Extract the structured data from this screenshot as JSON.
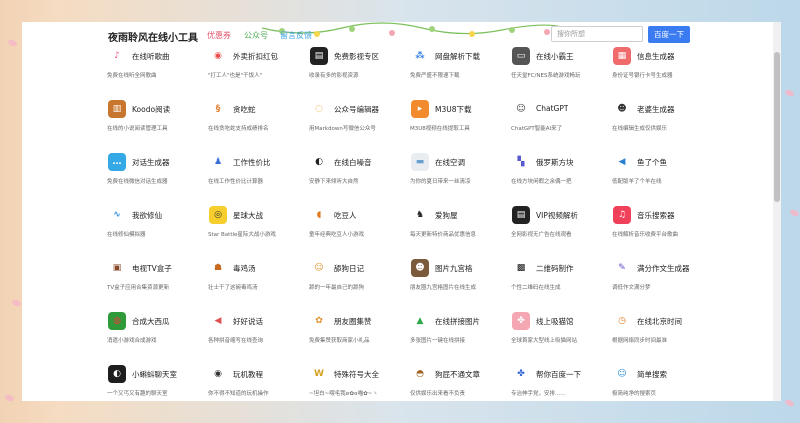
{
  "header": {
    "site_title": "夜雨聆风在线小工具",
    "nav": [
      {
        "label": "优惠券",
        "color": "#e2556c"
      },
      {
        "label": "公众号",
        "color": "#4caf50"
      },
      {
        "label": "留言反馈",
        "color": "#3aa0e0"
      }
    ],
    "search_placeholder": "搜你所想",
    "search_button": "百度一下"
  },
  "tools": [
    {
      "name": "在线听歌曲",
      "desc": "免费在线听全网歌曲",
      "icon": "music-note-icon",
      "glyph": "♪",
      "color": "#ffffff",
      "fg": "#e94c89"
    },
    {
      "name": "外卖折扣红包",
      "desc": "\"打工人\"也是\"干饭人\"",
      "icon": "food-bowl-icon",
      "glyph": "◉",
      "color": "#ffffff",
      "fg": "#e94c4c"
    },
    {
      "name": "免费影视专区",
      "desc": "收录有多的影视资源",
      "icon": "clapper-icon",
      "glyph": "▤",
      "color": "#222222",
      "fg": "#ffffff"
    },
    {
      "name": "网盘解析下载",
      "desc": "免费严盛不限速下载",
      "icon": "cloud-share-icon",
      "glyph": "⁂",
      "color": "#ffffff",
      "fg": "#2b7be5"
    },
    {
      "name": "在线小霸王",
      "desc": "任天堂FC/NES系统游戏畅玩",
      "icon": "game-console-icon",
      "glyph": "▭",
      "color": "#555555",
      "fg": "#ffffff"
    },
    {
      "name": "信息生成器",
      "desc": "身份证号银行卡号生成器",
      "icon": "id-card-icon",
      "glyph": "▦",
      "color": "#f06b6b",
      "fg": "#ffffff"
    },
    {
      "name": "Koodo阅读",
      "desc": "在线的小说阅读管理工具",
      "icon": "book-icon",
      "glyph": "▥",
      "color": "#c8752d",
      "fg": "#ffffff"
    },
    {
      "name": "贪吃蛇",
      "desc": "在线贪吃蛇支持成绩排名",
      "icon": "snake-icon",
      "glyph": "§",
      "color": "#ffffff",
      "fg": "#e07a2a"
    },
    {
      "name": "公众号编辑器",
      "desc": "用Markdown写微信公众号",
      "icon": "editor-swirl-icon",
      "glyph": "◌",
      "color": "#ffffff",
      "fg": "#f0a030"
    },
    {
      "name": "M3U8下载",
      "desc": "M3U8视频在线提取工具",
      "icon": "m3u8-icon",
      "glyph": "▸",
      "color": "#f28a2e",
      "fg": "#ffffff"
    },
    {
      "name": "ChatGPT",
      "desc": "ChatGPT智能AI来了",
      "icon": "robot-icon",
      "glyph": "☺",
      "color": "#ffffff",
      "fg": "#333333"
    },
    {
      "name": "老婆生成器",
      "desc": "在线编辑生成仅供娱乐",
      "icon": "girl-face-icon",
      "glyph": "☻",
      "color": "#ffffff",
      "fg": "#333333"
    },
    {
      "name": "对话生成器",
      "desc": "免费在线微信对话生成器",
      "icon": "chat-bubble-icon",
      "glyph": "…",
      "color": "#35a8e6",
      "fg": "#ffffff"
    },
    {
      "name": "工作性价比",
      "desc": "在线工作性价比计算器",
      "icon": "worker-icon",
      "glyph": "♟",
      "color": "#ffffff",
      "fg": "#3a6fd8"
    },
    {
      "name": "在线白噪音",
      "desc": "安静下来倾听大自然",
      "icon": "audio-headphone-icon",
      "glyph": "◐",
      "color": "#ffffff",
      "fg": "#222222"
    },
    {
      "name": "在线空调",
      "desc": "为你的夏日带来一丝清凉",
      "icon": "air-conditioner-icon",
      "glyph": "▬",
      "color": "#e9edf2",
      "fg": "#6aa0d0"
    },
    {
      "name": "俄罗斯方块",
      "desc": "在线方块闲暇之余偶一把",
      "icon": "tetris-icon",
      "glyph": "▚",
      "color": "#ffffff",
      "fg": "#5a5ad0"
    },
    {
      "name": "鱼了个鱼",
      "desc": "低配版羊了个羊在线",
      "icon": "fish-icon",
      "glyph": "◀",
      "color": "#ffffff",
      "fg": "#2a7fd0"
    },
    {
      "name": "我欲修仙",
      "desc": "在线修仙模拟器",
      "icon": "dragon-icon",
      "glyph": "∿",
      "color": "#ffffff",
      "fg": "#3a90d8"
    },
    {
      "name": "星球大战",
      "desc": "Star Battle星际大战小游戏",
      "icon": "planet-icon",
      "glyph": "◎",
      "color": "#f6cf2e",
      "fg": "#333333"
    },
    {
      "name": "吃豆人",
      "desc": "童年经典吃豆人小游戏",
      "icon": "pacman-icon",
      "glyph": "◖",
      "color": "#ffffff",
      "fg": "#e07a20"
    },
    {
      "name": "爱狗屋",
      "desc": "每天更新特价商品优惠信息",
      "icon": "dog-icon",
      "glyph": "♞",
      "color": "#ffffff",
      "fg": "#222222"
    },
    {
      "name": "VIP视频解析",
      "desc": "全网影视无广告在线观看",
      "icon": "clapperboard-icon",
      "glyph": "▤",
      "color": "#222222",
      "fg": "#ffffff"
    },
    {
      "name": "音乐搜索器",
      "desc": "在线解析音乐收费平台歌曲",
      "icon": "music-app-icon",
      "glyph": "♫",
      "color": "#f0405a",
      "fg": "#ffffff"
    },
    {
      "name": "电视TV盒子",
      "desc": "TV盒子应用合集资源更新",
      "icon": "tv-icon",
      "glyph": "▣",
      "color": "#ffffff",
      "fg": "#8a4a2a"
    },
    {
      "name": "毒鸡汤",
      "desc": "壮士干了这碗毒鸡汤",
      "icon": "roast-chicken-icon",
      "glyph": "☗",
      "color": "#ffffff",
      "fg": "#c86a20"
    },
    {
      "name": "舔狗日记",
      "desc": "舔的一年最自己的舔狗",
      "icon": "shiba-dog-icon",
      "glyph": "☺",
      "color": "#ffffff",
      "fg": "#e0902a"
    },
    {
      "name": "图片九宫格",
      "desc": "朋友圈九宫格图片在线生成",
      "icon": "portrait-icon",
      "glyph": "☻",
      "color": "#7a5a3a",
      "fg": "#ffffff"
    },
    {
      "name": "二维码制作",
      "desc": "个性二维码在线生成",
      "icon": "qrcode-icon",
      "glyph": "▩",
      "color": "#ffffff",
      "fg": "#111111"
    },
    {
      "name": "满分作文生成器",
      "desc": "调低作文满分梦",
      "icon": "quill-icon",
      "glyph": "✎",
      "color": "#ffffff",
      "fg": "#6a4fc8"
    },
    {
      "name": "合成大西瓜",
      "desc": "消遣小游戏合成游戏",
      "icon": "watermelon-icon",
      "glyph": "◍",
      "color": "#2e9a3a",
      "fg": "#e8403a"
    },
    {
      "name": "好好说话",
      "desc": "各种拼音缩写在线查询",
      "icon": "megaphone-icon",
      "glyph": "◀",
      "color": "#ffffff",
      "fg": "#e05050"
    },
    {
      "name": "朋友圈集赞",
      "desc": "免费集赞获取商家小礼品",
      "icon": "photo-color-wheel-icon",
      "glyph": "✿",
      "color": "#ffffff",
      "fg": "#e0902a"
    },
    {
      "name": "在线拼接图片",
      "desc": "多张图片一键在线拼接",
      "icon": "mountain-image-icon",
      "glyph": "▲",
      "color": "#ffffff",
      "fg": "#2ea84a"
    },
    {
      "name": "线上吸猫馆",
      "desc": "全球首家大型线上吸猫网站",
      "icon": "cat-paw-icon",
      "glyph": "✤",
      "color": "#f4a6b2",
      "fg": "#ffffff"
    },
    {
      "name": "在线北京时间",
      "desc": "根据网络同步时间最准",
      "icon": "clock-icon",
      "glyph": "◷",
      "color": "#ffffff",
      "fg": "#e0802a"
    },
    {
      "name": "小蝌蚪聊天室",
      "desc": "一个又丐又有趣的聊天室",
      "icon": "tadpole-icon",
      "glyph": "◐",
      "color": "#1e1e1e",
      "fg": "#ffffff"
    },
    {
      "name": "玩机教程",
      "desc": "你不得不知道的玩机操作",
      "icon": "steering-wheel-icon",
      "glyph": "◉",
      "color": "#ffffff",
      "fg": "#333333"
    },
    {
      "name": "特殊符号大全",
      "desc": "~坦白~喂毛我ʚ✿ɞ喵✿~ヽ",
      "icon": "symbol-w-icon",
      "glyph": "W",
      "color": "#ffffff",
      "fg": "#d8a020"
    },
    {
      "name": "狗屁不通文章",
      "desc": "仅供娱乐出来看不负责",
      "icon": "poop-icon",
      "glyph": "◓",
      "color": "#ffffff",
      "fg": "#a06020"
    },
    {
      "name": "帮你百度一下",
      "desc": "专治伸手党，安排......",
      "icon": "baidu-paw-icon",
      "glyph": "✤",
      "color": "#ffffff",
      "fg": "#2b5fd8"
    },
    {
      "name": "简单搜索",
      "desc": "极简纯净的搜索页",
      "icon": "search-mascot-icon",
      "glyph": "☺",
      "color": "#ffffff",
      "fg": "#2b8fd8"
    }
  ]
}
